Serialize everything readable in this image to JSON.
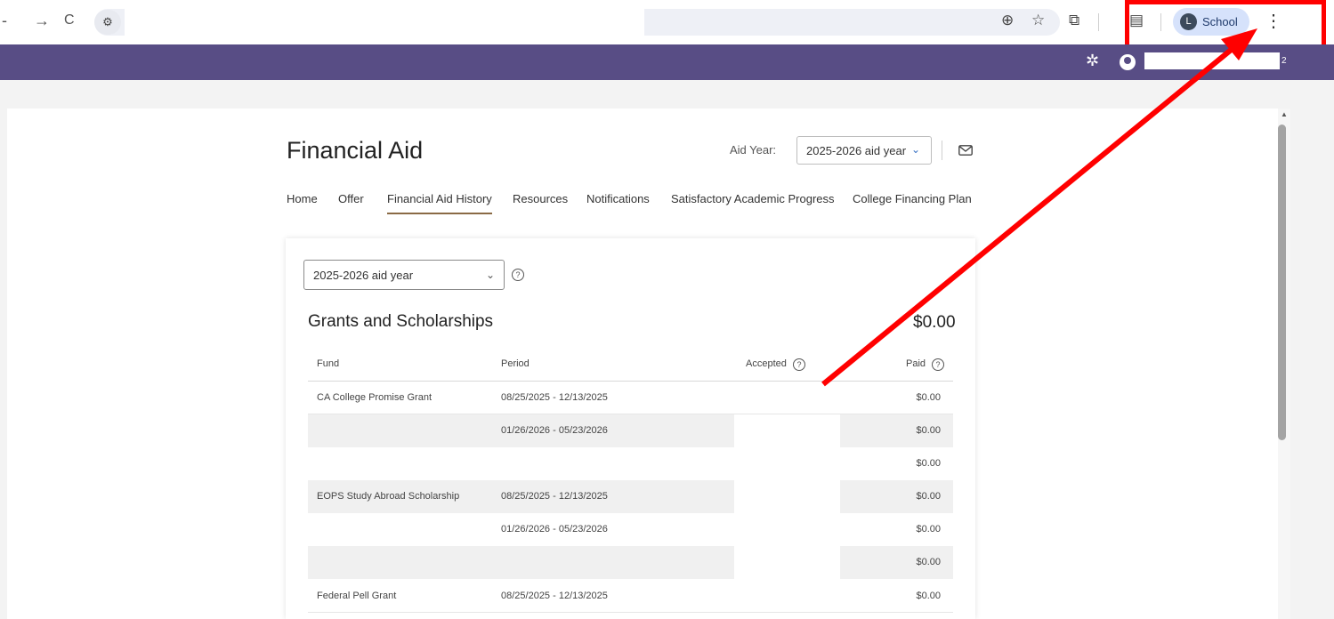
{
  "browser": {
    "back_glyph": "-",
    "forward_glyph": "→",
    "reload_glyph": "C",
    "site_info_glyph": "⚙",
    "zoom_glyph": "⊕",
    "star_glyph": "☆",
    "extensions_glyph": "⧉",
    "reader_glyph": "▤",
    "profile": {
      "initial": "L",
      "name": "School"
    },
    "menu_glyph": "⋮"
  },
  "appbar": {
    "gear_glyph": "✲",
    "user_suffix": "2"
  },
  "page": {
    "title": "Financial Aid",
    "aid_year_label": "Aid Year:",
    "aid_year_value": "2025-2026 aid year",
    "tabs": [
      {
        "label": "Home"
      },
      {
        "label": "Offer"
      },
      {
        "label": "Financial Aid History"
      },
      {
        "label": "Resources"
      },
      {
        "label": "Notifications"
      },
      {
        "label": "Satisfactory Academic Progress"
      },
      {
        "label": "College Financing Plan"
      }
    ]
  },
  "card": {
    "year_select": "2025-2026 aid year",
    "section_title": "Grants and Scholarships",
    "section_total": "$0.00",
    "columns": {
      "fund": "Fund",
      "period": "Period",
      "accepted": "Accepted",
      "paid": "Paid"
    },
    "rows": [
      {
        "fund": "CA College Promise Grant",
        "period": "08/25/2025 - 12/13/2025",
        "paid": "$0.00"
      },
      {
        "fund": "",
        "period": "01/26/2026 - 05/23/2026",
        "paid": "$0.00"
      },
      {
        "fund": "",
        "period": "",
        "paid": "$0.00"
      },
      {
        "fund": "EOPS Study Abroad Scholarship",
        "period": "08/25/2025 - 12/13/2025",
        "paid": "$0.00"
      },
      {
        "fund": "",
        "period": "01/26/2026 - 05/23/2026",
        "paid": "$0.00"
      },
      {
        "fund": "",
        "period": "",
        "paid": "$0.00"
      },
      {
        "fund": "Federal Pell Grant",
        "period": "08/25/2025 - 12/13/2025",
        "paid": "$0.00"
      }
    ]
  },
  "colors": {
    "appbar": "#584d85",
    "annotation": "#ff0000",
    "tab_underline": "#8a6a45"
  }
}
